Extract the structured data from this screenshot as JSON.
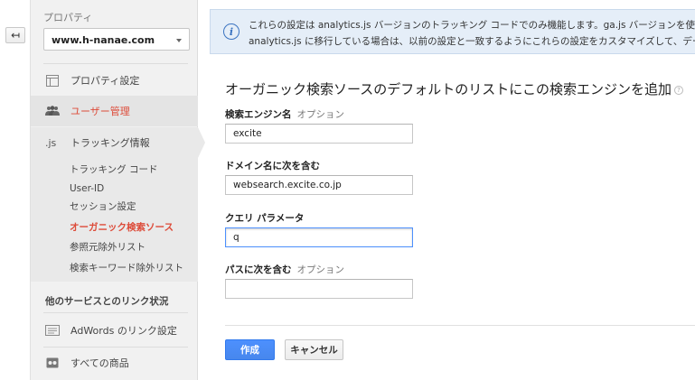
{
  "nav": {
    "back_icon": "back-arrow-icon"
  },
  "sidebar": {
    "property_label": "プロパティ",
    "property_value": "www.h-nanae.com",
    "items": [
      {
        "label": "プロパティ設定",
        "icon": "settings-page-icon"
      },
      {
        "label": "ユーザー管理",
        "icon": "users-icon"
      },
      {
        "label": "トラッキング情報",
        "icon_text": ".js"
      }
    ],
    "sub_items": [
      {
        "label": "トラッキング コード"
      },
      {
        "label": "User-ID"
      },
      {
        "label": "セッション設定"
      },
      {
        "label": "オーガニック検索ソース"
      },
      {
        "label": "参照元除外リスト"
      },
      {
        "label": "検索キーワード除外リスト"
      }
    ],
    "section_head": "他のサービスとのリンク状況",
    "link_items": [
      {
        "label": "AdWords のリンク設定",
        "icon": "adwords-icon"
      },
      {
        "label": "すべての商品",
        "icon": "products-icon"
      }
    ]
  },
  "banner": {
    "icon": "info-icon",
    "line1": "これらの設定は analytics.js バージョンのトラッキング コードでのみ機能します。ga.js バージョンを使用して",
    "line2": "analytics.js に移行している場合は、以前の設定と一致するようにこれらの設定をカスタマイズして、データの"
  },
  "form": {
    "title": "オーガニック検索ソースのデフォルトのリストにこの検索エンジンを追加",
    "help": "?",
    "fields": [
      {
        "label": "検索エンジン名",
        "optional": "オプション",
        "value": "excite"
      },
      {
        "label": "ドメイン名に次を含む",
        "optional": "",
        "value": "websearch.excite.co.jp"
      },
      {
        "label": "クエリ パラメータ",
        "optional": "",
        "value": "q"
      },
      {
        "label": "パスに次を含む",
        "optional": "オプション",
        "value": ""
      }
    ],
    "create_label": "作成",
    "cancel_label": "キャンセル"
  },
  "colors": {
    "active_red": "#dd4b39",
    "primary_blue": "#4d90fe",
    "banner_bg": "#e5eef8"
  }
}
